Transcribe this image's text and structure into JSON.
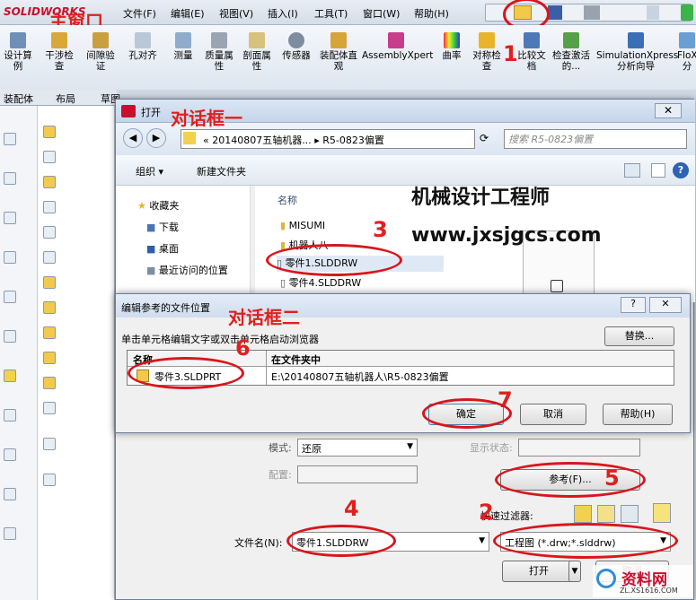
{
  "main_window": {
    "logo": "SOLIDWORKS",
    "menu": [
      "文件(F)",
      "编辑(E)",
      "视图(V)",
      "插入(I)",
      "工具(T)",
      "窗口(W)",
      "帮助(H)"
    ],
    "toolbar": [
      "设计算例",
      "干涉检查",
      "间隙验证",
      "孔对齐",
      "测量",
      "质量属性",
      "剖面属性",
      "传感器",
      "装配体直观",
      "AssemblyXpert",
      "曲率",
      "对称检查",
      "比较文档",
      "检查激活的...",
      "SimulationXpress 分析向导",
      "FloXpress 分"
    ],
    "tabs": [
      "装配体",
      "布局",
      "草图"
    ],
    "annotation": "主窗口"
  },
  "open_dialog": {
    "title": "打开",
    "annotation": "对话框一",
    "breadcrumb": "« 20140807五轴机器... ▸ R5-0823偏置",
    "search_placeholder": "搜索 R5-0823偏置",
    "organize": "组织 ▾",
    "new_folder": "新建文件夹",
    "nav": [
      "收藏夹",
      "下载",
      "桌面",
      "最近访问的位置"
    ],
    "list_header": "名称",
    "files": [
      "MISUMI",
      "机器人八",
      "零件1.SLDDRW",
      "零件4.SLDDRW"
    ],
    "mode_label": "模式:",
    "mode_value": "还原",
    "display_state_label": "显示状态:",
    "config_label": "配置:",
    "reference_button": "参考(F)...",
    "quick_filter": "快速过滤器:",
    "filename_label": "文件名(N):",
    "filename_value": "零件1.SLDDRW",
    "filetype_value": "工程图 (*.drw;*.slddrw)",
    "open_button": "打开",
    "cancel_button": "取消"
  },
  "ref_dialog": {
    "title": "编辑参考的文件位置",
    "annotation": "对话框二",
    "instruction": "单击单元格编辑文字或双击单元格启动浏览器",
    "replace_button": "替换...",
    "col_name": "名称",
    "col_folder": "在文件夹中",
    "rows": [
      {
        "name": "零件3.SLDPRT",
        "folder": "E:\\20140807五轴机器人\\R5-0823偏置"
      }
    ],
    "ok_button": "确定",
    "cancel_button": "取消",
    "help_button": "帮助(H)"
  },
  "watermark": {
    "line1": "机械设计工程师",
    "line2": "www.jxsjgcs.com",
    "bottom": "资料网",
    "bottom_url": "ZL.XS1616.COM"
  },
  "steps": [
    "1",
    "2",
    "3",
    "4",
    "5",
    "6",
    "7"
  ]
}
